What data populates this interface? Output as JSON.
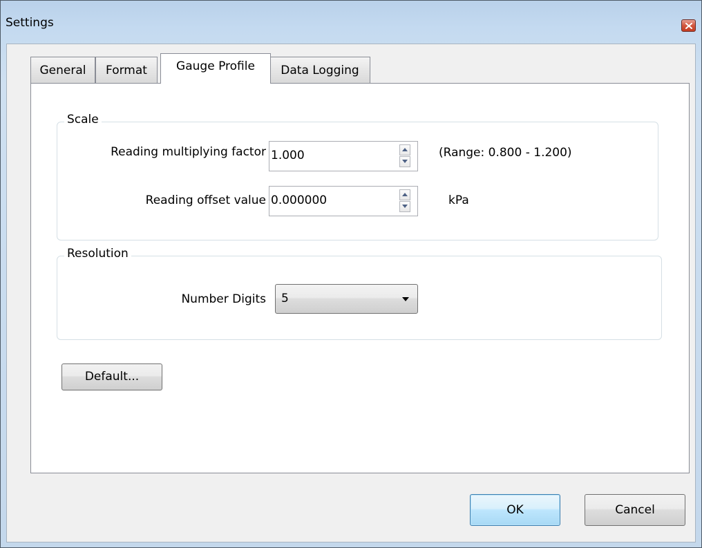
{
  "window": {
    "title": "Settings",
    "close_icon": "close-icon"
  },
  "tabs": [
    {
      "label": "General",
      "active": false
    },
    {
      "label": "Format",
      "active": false
    },
    {
      "label": "Gauge Profile",
      "active": true
    },
    {
      "label": "Data Logging",
      "active": false
    }
  ],
  "scale": {
    "legend": "Scale",
    "multiplying_factor": {
      "label": "Reading multiplying factor",
      "value": "1.000",
      "hint": "(Range: 0.800 - 1.200)"
    },
    "offset": {
      "label": "Reading offset value",
      "value": "0.000000",
      "unit": "kPa"
    }
  },
  "resolution": {
    "legend": "Resolution",
    "number_digits": {
      "label": "Number Digits",
      "value": "5"
    }
  },
  "buttons": {
    "default_label": "Default...",
    "ok_label": "OK",
    "cancel_label": "Cancel"
  },
  "colors": {
    "accent_border": "#3c7fb1",
    "close_button": "#c43c22"
  }
}
